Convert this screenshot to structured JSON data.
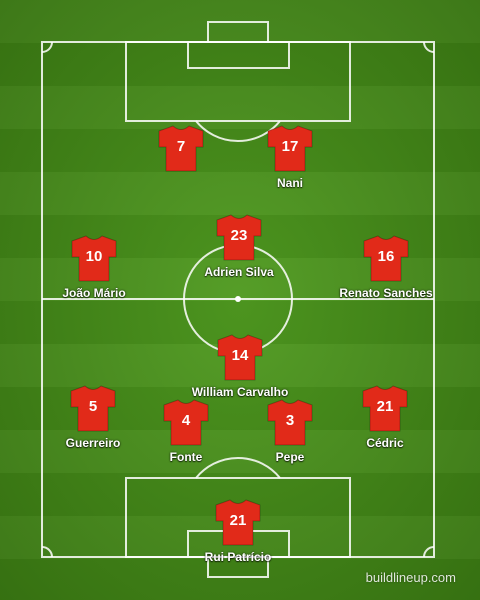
{
  "shirt_color": "#e12a19",
  "players": [
    {
      "number": "7",
      "name": ""
    },
    {
      "number": "17",
      "name": "Nani"
    },
    {
      "number": "23",
      "name": "Adrien Silva"
    },
    {
      "number": "10",
      "name": "João Mário"
    },
    {
      "number": "16",
      "name": "Renato Sanches"
    },
    {
      "number": "14",
      "name": "William Carvalho"
    },
    {
      "number": "5",
      "name": "Guerreiro"
    },
    {
      "number": "4",
      "name": "Fonte"
    },
    {
      "number": "3",
      "name": "Pepe"
    },
    {
      "number": "21",
      "name": "Cédric"
    },
    {
      "number": "21",
      "name": "Rui Patrício"
    }
  ],
  "watermark": "buildlineup.com"
}
